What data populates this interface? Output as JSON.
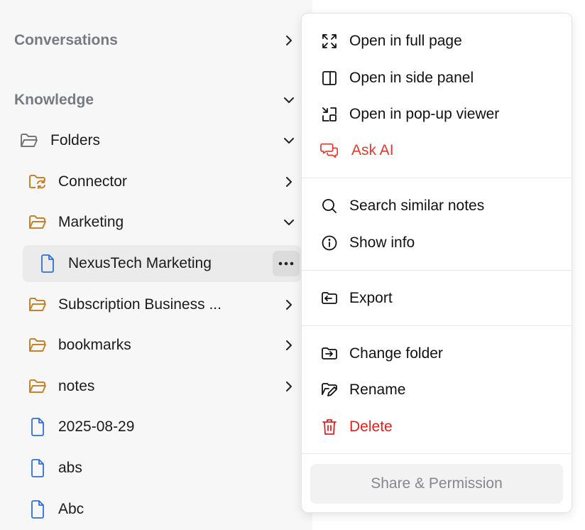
{
  "sidebar": {
    "conversations": "Conversations",
    "knowledge": "Knowledge",
    "folders": "Folders",
    "items": [
      {
        "label": "Connector"
      },
      {
        "label": "Marketing"
      },
      {
        "label": "NexusTech Marketing"
      },
      {
        "label": "Subscription Business ..."
      },
      {
        "label": "bookmarks"
      },
      {
        "label": "notes"
      },
      {
        "label": "2025-08-29"
      },
      {
        "label": "abs"
      },
      {
        "label": "Abc"
      }
    ]
  },
  "menu": {
    "open_full_page": "Open in full page",
    "open_side_panel": "Open in side panel",
    "open_popup": "Open in pop-up viewer",
    "ask_ai": "Ask AI",
    "search_similar": "Search similar notes",
    "show_info": "Show info",
    "export": "Export",
    "change_folder": "Change folder",
    "rename": "Rename",
    "delete": "Delete",
    "share_permission": "Share & Permission"
  },
  "colors": {
    "folder": "#c8822a",
    "file": "#2f6fd6",
    "ask_ai": "#e03a2f",
    "delete": "#e0201e",
    "sidebar_bg": "#f7f7f7"
  }
}
